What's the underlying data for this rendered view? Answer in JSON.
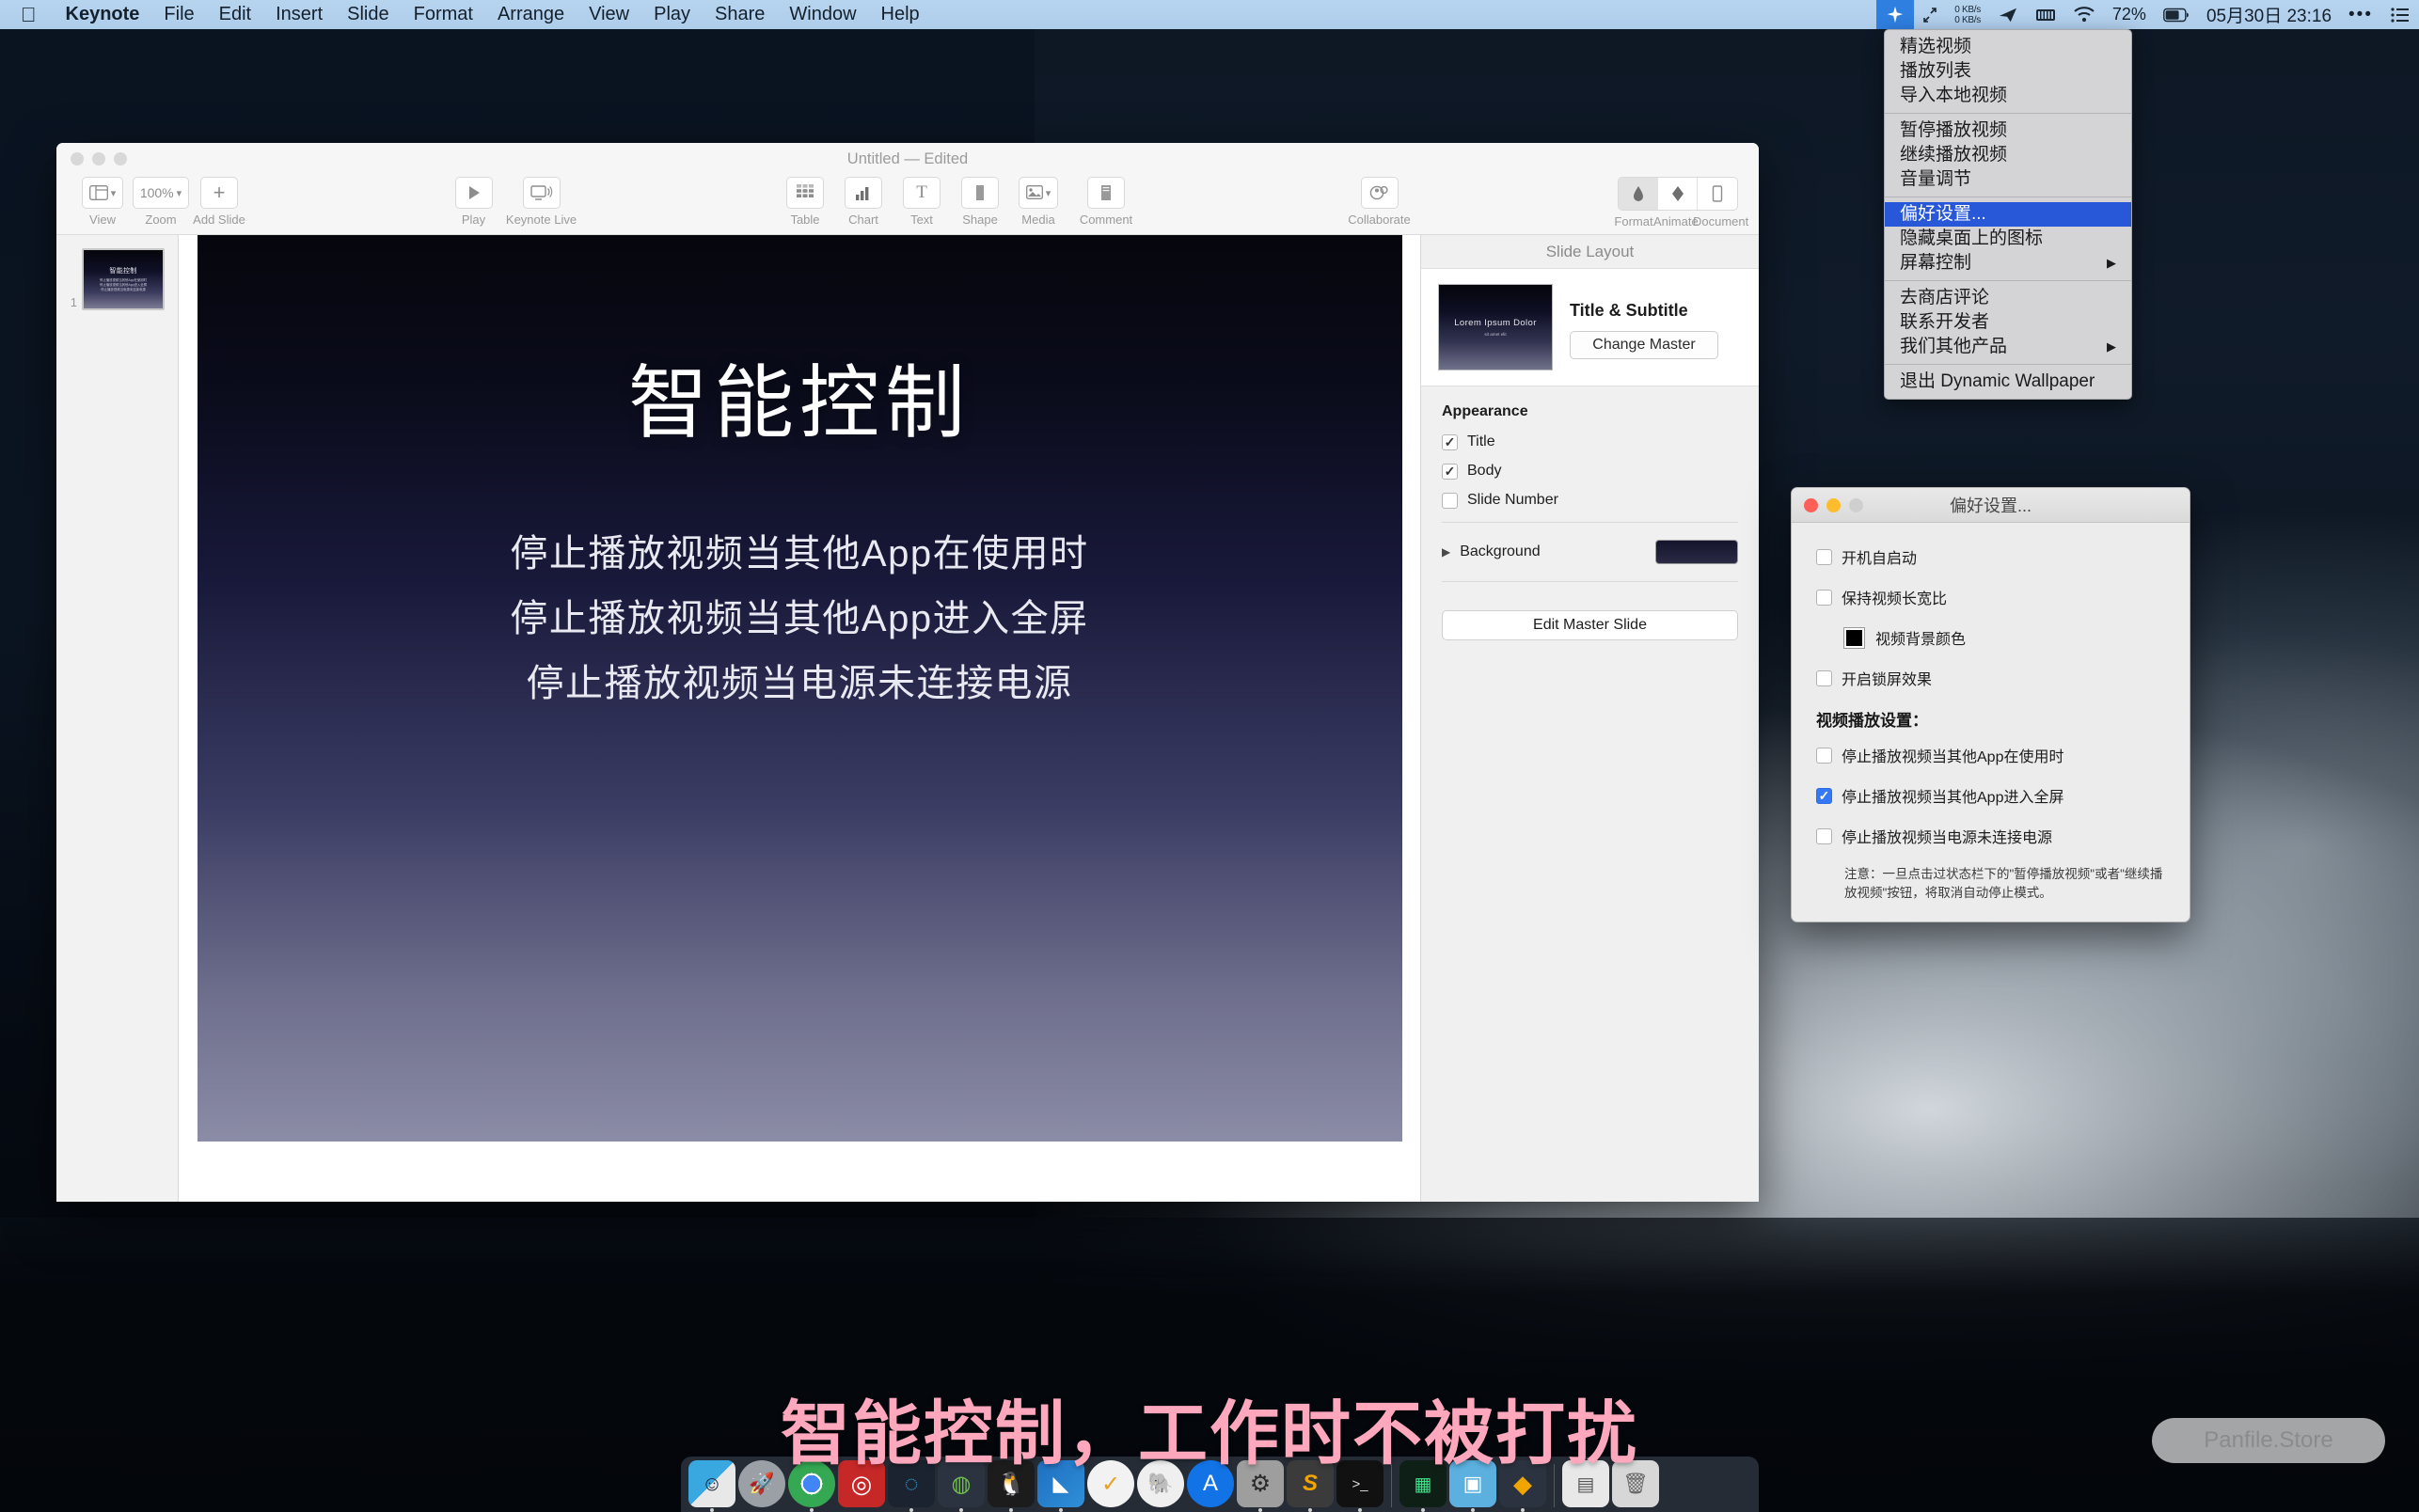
{
  "menubar": {
    "apple_icon": "apple-logo",
    "items": [
      "Keynote",
      "File",
      "Edit",
      "Insert",
      "Slide",
      "Format",
      "Arrange",
      "View",
      "Play",
      "Share",
      "Window",
      "Help"
    ],
    "status": {
      "dynamic_wallpaper_icon": "sparkle-star-icon",
      "shortcut_icon": "diagonal-arrows-icon",
      "net_up": "0 KB/s",
      "net_down": "0 KB/s",
      "telegram_icon": "paper-plane-icon",
      "battery_bar_icon": "battery-bars-icon",
      "wifi_icon": "wifi-icon",
      "battery_percent": "72%",
      "battery_icon": "battery-icon",
      "clock": "05月30日 23:16",
      "more_icon": "ellipsis-icon",
      "control_center_icon": "list-lines-icon"
    }
  },
  "dynamic_wallpaper_menu": {
    "groups": [
      [
        "精选视频",
        "播放列表",
        "导入本地视频"
      ],
      [
        "暂停播放视频",
        "继续播放视频",
        "音量调节"
      ],
      [
        "偏好设置...",
        "隐藏桌面上的图标",
        "屏幕控制"
      ],
      [
        "去商店评论",
        "联系开发者",
        "我们其他产品"
      ],
      [
        "退出 Dynamic Wallpaper"
      ]
    ],
    "selected": "偏好设置...",
    "submenu_items": [
      "屏幕控制",
      "我们其他产品"
    ],
    "submenu_arrow": "▶"
  },
  "preferences": {
    "title": "偏好设置...",
    "traffic_lights": [
      "close",
      "minimize",
      "zoom"
    ],
    "options": [
      {
        "label": "开机自启动",
        "checked": false
      },
      {
        "label": "保持视频长宽比",
        "checked": false
      }
    ],
    "color_row": {
      "label": "视频背景颜色",
      "color": "#000000"
    },
    "lock_option": {
      "label": "开启锁屏效果",
      "checked": false
    },
    "section_title": "视频播放设置：",
    "playback_options": [
      {
        "label": "停止播放视频当其他App在使用时",
        "checked": false
      },
      {
        "label": "停止播放视频当其他App进入全屏",
        "checked": true
      },
      {
        "label": "停止播放视频当电源未连接电源",
        "checked": false
      }
    ],
    "note": "注意：一旦点击过状态栏下的\"暂停播放视频\"或者\"继续播放视频\"按钮，将取消自动停止模式。",
    "accent_color": "#3478f6"
  },
  "keynote": {
    "window_title": "Untitled — Edited",
    "toolbar_left": [
      {
        "label": "View",
        "icon": "view-layout-icon"
      },
      {
        "label": "Zoom",
        "icon": "zoom-percent",
        "value": "100%"
      },
      {
        "label": "Add Slide",
        "icon": "plus-icon"
      }
    ],
    "toolbar_center": [
      {
        "label": "Play",
        "icon": "play-triangle-icon"
      },
      {
        "label": "Keynote Live",
        "icon": "display-broadcast-icon"
      }
    ],
    "toolbar_insert": [
      {
        "label": "Table",
        "icon": "table-grid-icon"
      },
      {
        "label": "Chart",
        "icon": "bar-chart-icon"
      },
      {
        "label": "Text",
        "icon": "text-t-icon"
      },
      {
        "label": "Shape",
        "icon": "shape-square-icon"
      },
      {
        "label": "Media",
        "icon": "media-photo-icon"
      },
      {
        "label": "Comment",
        "icon": "comment-note-icon"
      }
    ],
    "toolbar_collaborate": {
      "label": "Collaborate",
      "icon": "collaborate-person-icon"
    },
    "toolbar_right": [
      {
        "label": "Format",
        "icon": "paintbrush-icon",
        "active": true
      },
      {
        "label": "Animate",
        "icon": "diamond-icon",
        "active": false
      },
      {
        "label": "Document",
        "icon": "document-page-icon",
        "active": false
      }
    ],
    "sidebar": {
      "slides": [
        {
          "number": "1",
          "title": "智能控制",
          "body": "停止播放视频当其他App在使用时\n停止播放视频当其他App进入全屏\n停止播放视频当电源未连接电源"
        }
      ]
    },
    "slide": {
      "title": "智能控制",
      "body_lines": [
        "停止播放视频当其他App在使用时",
        "停止播放视频当其他App进入全屏",
        "停止播放视频当电源未连接电源"
      ]
    },
    "inspector": {
      "header": "Slide Layout",
      "master_name": "Title & Subtitle",
      "master_thumb_title": "Lorem Ipsum Dolor",
      "master_thumb_sub": "sit amet elit",
      "change_master_label": "Change Master",
      "appearance_title": "Appearance",
      "appearance_items": [
        {
          "label": "Title",
          "checked": true
        },
        {
          "label": "Body",
          "checked": true
        },
        {
          "label": "Slide Number",
          "checked": false
        }
      ],
      "background_label": "Background",
      "background_color": "#1e1e3a",
      "edit_master_label": "Edit Master Slide"
    }
  },
  "caption": "智能控制，工作时不被打扰",
  "watermark": "Panfile.Store",
  "dock": {
    "items": [
      {
        "name": "finder",
        "glyph": "🙂",
        "running": true,
        "bg": "#2f8fd0"
      },
      {
        "name": "launchpad",
        "glyph": "🚀",
        "running": false,
        "bg": "#9aa0a6"
      },
      {
        "name": "google-chrome",
        "glyph": "◉",
        "running": true,
        "bg": "#f5f5f5"
      },
      {
        "name": "netease-music",
        "glyph": "◎",
        "running": false,
        "bg": "#c62828"
      },
      {
        "name": "dingtalk",
        "glyph": "◌",
        "running": true,
        "bg": "#10a5e8"
      },
      {
        "name": "wechat",
        "glyph": "◍",
        "running": true,
        "bg": "#4caf50"
      },
      {
        "name": "qq",
        "glyph": "🐧",
        "running": true,
        "bg": "#1a1a1a"
      },
      {
        "name": "keynote",
        "glyph": "◣",
        "running": true,
        "bg": "#1f6fc0"
      },
      {
        "name": "todo-circle",
        "glyph": "✓",
        "running": false,
        "bg": "#f0f0f0"
      },
      {
        "name": "evernote",
        "glyph": "🐘",
        "running": false,
        "bg": "#eeeeee"
      },
      {
        "name": "app-store",
        "glyph": "Ⓐ",
        "running": false,
        "bg": "#1273e6"
      },
      {
        "name": "system-preferences",
        "glyph": "⚙",
        "running": true,
        "bg": "#9e9e9e"
      },
      {
        "name": "sublime-text",
        "glyph": "S",
        "running": true,
        "bg": "#3b3b3b"
      },
      {
        "name": "terminal",
        "glyph": ">_",
        "running": true,
        "bg": "#111111"
      },
      {
        "name": "activity-monitor",
        "glyph": "▦",
        "running": true,
        "bg": "#122016"
      },
      {
        "name": "keynote-presenter",
        "glyph": "▣",
        "running": true,
        "bg": "#5bb0e0"
      },
      {
        "name": "sketch",
        "glyph": "◆",
        "running": true,
        "bg": "#f0a500"
      },
      {
        "name": "downloads-folder",
        "glyph": "▤",
        "running": false,
        "bg": "#e8e8e8"
      },
      {
        "name": "trash",
        "glyph": "🗑",
        "running": false,
        "bg": "#d7d7d7"
      }
    ]
  }
}
